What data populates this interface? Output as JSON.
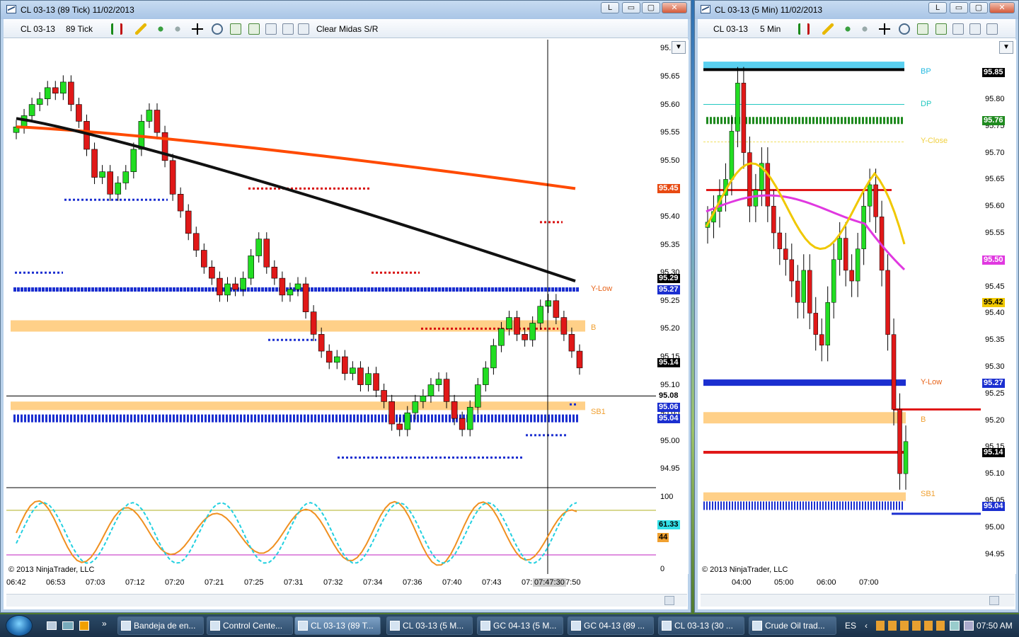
{
  "left_window": {
    "title": "CL 03-13  (89 Tick)  11/02/2013",
    "toolbar": {
      "instrument": "CL 03-13",
      "interval": "89 Tick",
      "indicator_name": "Clear Midas S/R"
    },
    "y_ticks": [
      "95.",
      "95.65",
      "95.60",
      "95.55",
      "95.50",
      "95.45",
      "95.40",
      "95.35",
      "95.30",
      "95.25",
      "95.20",
      "95.15",
      "95.10",
      "95.05",
      "95.00",
      "94.95"
    ],
    "price_tags": [
      {
        "text": "95.45",
        "bg": "#e84a12",
        "fg": "#fff"
      },
      {
        "text": "95.29",
        "bg": "#000000",
        "fg": "#fff"
      },
      {
        "text": "95.27",
        "bg": "#1b2fd0",
        "fg": "#fff"
      },
      {
        "text": "95.14",
        "bg": "#000000",
        "fg": "#fff"
      },
      {
        "text": "95.08",
        "bg": "#ffffff",
        "fg": "#000"
      },
      {
        "text": "95.06",
        "bg": "#1b2fd0",
        "fg": "#fff"
      },
      {
        "text": "95.04",
        "bg": "#1b2fd0",
        "fg": "#fff"
      }
    ],
    "level_labels": [
      {
        "text": "Y-Low",
        "color": "#e8641a"
      },
      {
        "text": "B",
        "color": "#f0a030"
      },
      {
        "text": "SB1",
        "color": "#f0a030"
      }
    ],
    "osc_ticks": [
      "100",
      "0"
    ],
    "osc_tags": [
      {
        "text": "61.33",
        "bg": "#33e0e8",
        "fg": "#000"
      },
      {
        "text": "44",
        "bg": "#f0a030",
        "fg": "#000"
      }
    ],
    "x_ticks": [
      "06:42",
      "06:53",
      "07:03",
      "07:12",
      "07:20",
      "07:21",
      "07:25",
      "07:31",
      "07:32",
      "07:34",
      "07:36",
      "07:40",
      "07:43",
      "07:",
      "07:50"
    ],
    "crosshair_time": "07:47:30",
    "copyright": "© 2013 NinjaTrader, LLC"
  },
  "right_window": {
    "title": "CL 03-13  (5 Min)  11/02/2013",
    "toolbar": {
      "instrument": "CL 03-13",
      "interval": "5 Min"
    },
    "y_ticks": [
      "95.",
      "95.80",
      "95.75",
      "95.70",
      "95.65",
      "95.60",
      "95.55",
      "95.50",
      "95.45",
      "95.40",
      "95.35",
      "95.30",
      "95.25",
      "95.20",
      "95.15",
      "95.10",
      "95.05",
      "95.00",
      "94.95"
    ],
    "price_tags": [
      {
        "text": "95.85",
        "bg": "#000000",
        "fg": "#fff"
      },
      {
        "text": "95.76",
        "bg": "#1f8a1f",
        "fg": "#fff"
      },
      {
        "text": "95.50",
        "bg": "#e038e0",
        "fg": "#fff"
      },
      {
        "text": "95.42",
        "bg": "#f0c800",
        "fg": "#000"
      },
      {
        "text": "95.27",
        "bg": "#1b2fd0",
        "fg": "#fff"
      },
      {
        "text": "95.14",
        "bg": "#000000",
        "fg": "#fff"
      },
      {
        "text": "95.04",
        "bg": "#1b2fd0",
        "fg": "#fff"
      }
    ],
    "level_labels": [
      {
        "text": "BP",
        "color": "#22b8e0"
      },
      {
        "text": "DP",
        "color": "#22c8c0"
      },
      {
        "text": "Y-Close",
        "color": "#f0d040"
      },
      {
        "text": "Y-Low",
        "color": "#e8641a"
      },
      {
        "text": "B",
        "color": "#f0a030"
      },
      {
        "text": "SB1",
        "color": "#f0a030"
      }
    ],
    "x_ticks": [
      "04:00",
      "05:00",
      "06:00",
      "07:00"
    ],
    "copyright": "© 2013 NinjaTrader, LLC"
  },
  "window_buttons": {
    "layout": "L",
    "minimize": "▭",
    "maximize": "▢",
    "close": "✕"
  },
  "taskbar": {
    "buttons": [
      {
        "label": "Bandeja de en..."
      },
      {
        "label": "Control Cente..."
      },
      {
        "label": "CL 03-13 (89 T..."
      },
      {
        "label": "CL 03-13 (5 M..."
      },
      {
        "label": "GC 04-13 (5 M..."
      },
      {
        "label": "GC 04-13 (89 ..."
      },
      {
        "label": "CL 03-13 (30 ..."
      },
      {
        "label": "Crude Oil trad..."
      }
    ],
    "language": "ES",
    "clock": "07:50 AM"
  },
  "colors": {
    "bull": "#22dd22",
    "bear": "#e01818",
    "orange_ma": "#ff4a00",
    "black_ma": "#111111",
    "blue_level": "#1b2fd0",
    "red_dots": "#d81010",
    "band": "#ffc060"
  }
}
